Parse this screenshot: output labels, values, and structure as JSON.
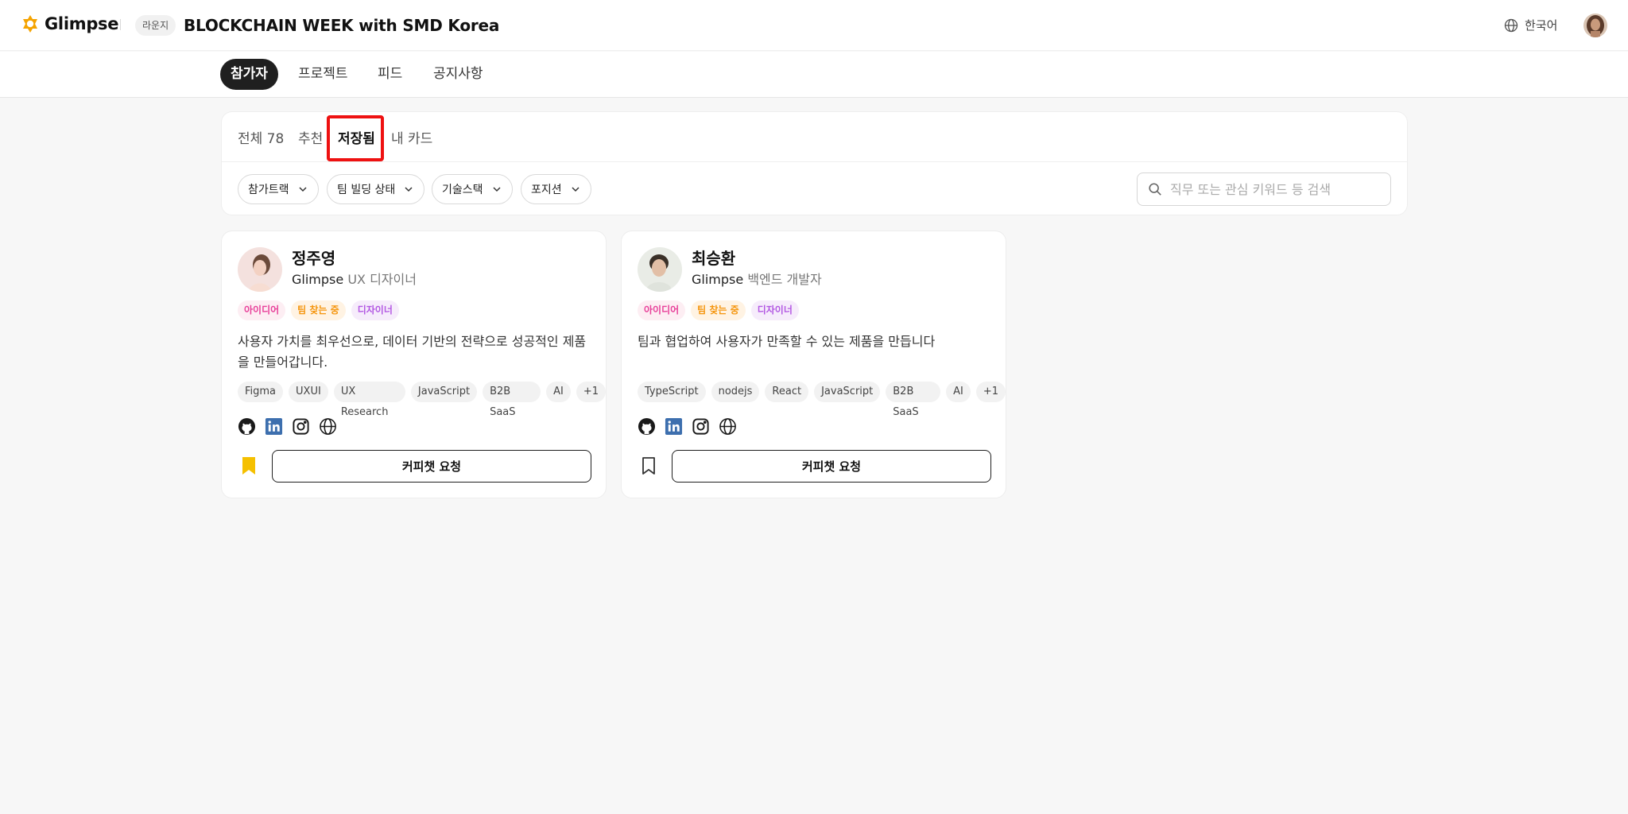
{
  "header": {
    "logo_text": "Glimpse",
    "lounge_badge": "라운지",
    "event_title": "BLOCKCHAIN WEEK with SMD Korea",
    "language": "한국어"
  },
  "main_tabs": [
    {
      "label": "참가자",
      "active": true
    },
    {
      "label": "프로젝트",
      "active": false
    },
    {
      "label": "피드",
      "active": false
    },
    {
      "label": "공지사항",
      "active": false
    }
  ],
  "sub_tabs": [
    {
      "label": "전체 78",
      "active": false
    },
    {
      "label": "추천",
      "active": false
    },
    {
      "label": "저장됨",
      "active": true
    },
    {
      "label": "내 카드",
      "active": false
    }
  ],
  "filters": [
    "참가트랙",
    "팀 빌딩 상태",
    "기술스택",
    "포지션"
  ],
  "search": {
    "placeholder": "직무 또는 관심 키워드 등 검색"
  },
  "cards": [
    {
      "name": "정주영",
      "company": "Glimpse",
      "position": "UX 디자이너",
      "chips": [
        "아이디어",
        "팀 찾는 중",
        "디자이너"
      ],
      "description": "사용자 가치를 최우선으로, 데이터 기반의 전략으로 성공적인 제품을 만들어갑니다.",
      "tags": [
        "Figma",
        "UXUI",
        "UX Research",
        "JavaScript",
        "B2B SaaS",
        "AI",
        "+1"
      ],
      "saved": true,
      "button_label": "커피챗 요청"
    },
    {
      "name": "최승환",
      "company": "Glimpse",
      "position": "백엔드 개발자",
      "chips": [
        "아이디어",
        "팀 찾는 중",
        "디자이너"
      ],
      "description": "팀과 협업하여 사용자가 만족할 수 있는 제품을 만듭니다",
      "tags": [
        "TypeScript",
        "nodejs",
        "React",
        "JavaScript",
        "B2B SaaS",
        "AI",
        "+1"
      ],
      "saved": false,
      "button_label": "커피챗 요청"
    }
  ],
  "colors": {
    "brand": "#f5a300",
    "bookmark_saved": "#f5c000",
    "highlight": "#ee1111",
    "linkedin": "#3d6fae"
  }
}
